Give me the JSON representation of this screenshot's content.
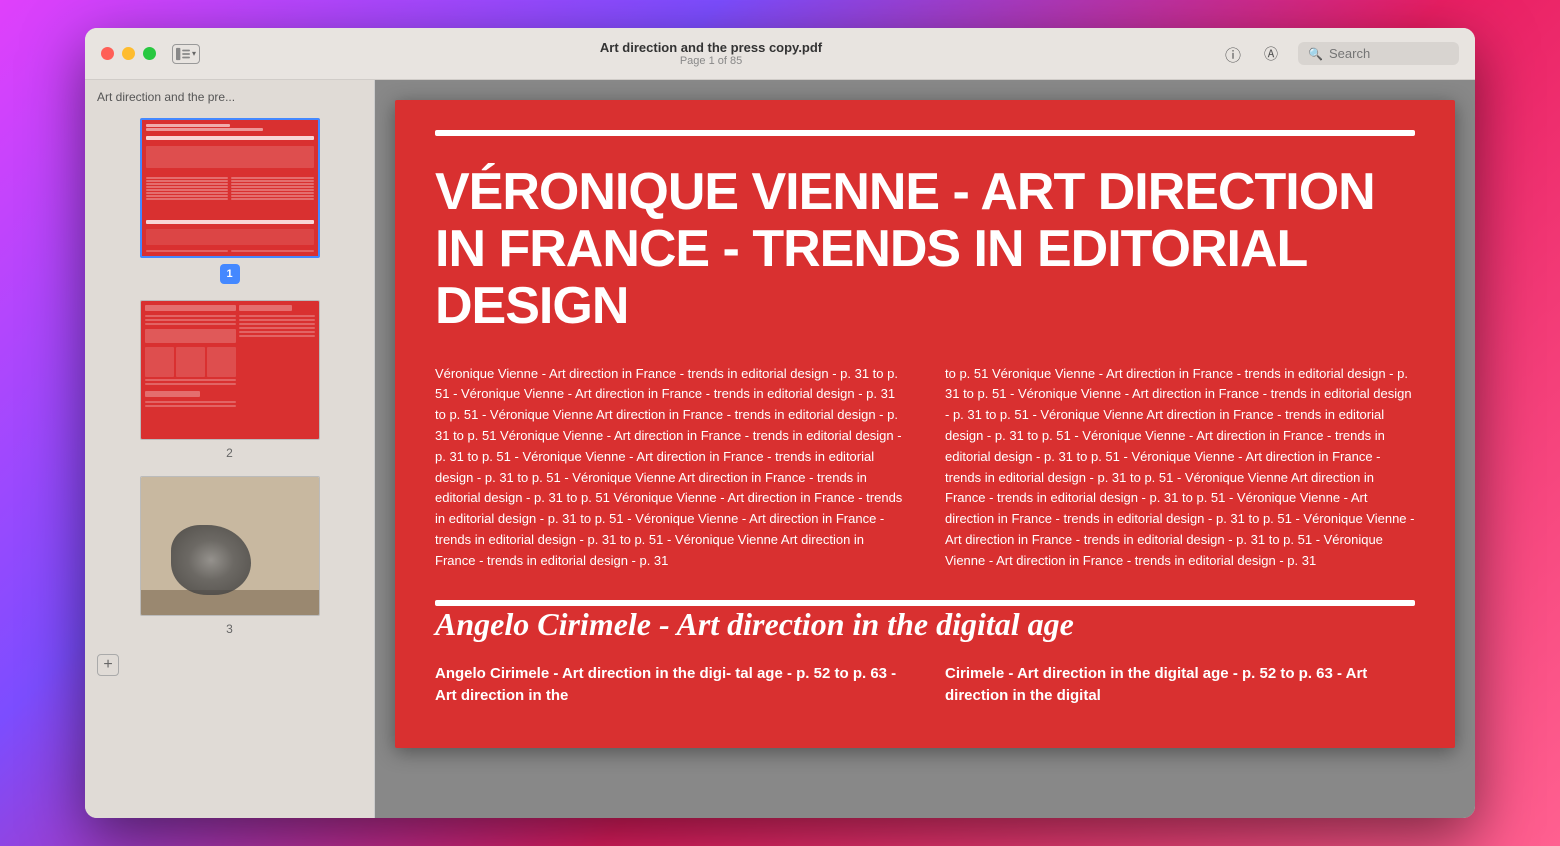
{
  "window": {
    "title": "Art direction and the press copy.pdf",
    "page_info": "Page 1 of 85",
    "search_placeholder": "Search"
  },
  "sidebar": {
    "header": "Art direction and the pre...",
    "pages": [
      {
        "num": "1",
        "label": "1",
        "active": true
      },
      {
        "num": "2",
        "label": "2",
        "active": false
      },
      {
        "num": "3",
        "label": "3",
        "active": false
      }
    ],
    "add_button": "+"
  },
  "pdf": {
    "main_title": "VÉRONIQUE VIENNE - ART DIRECTION IN FRANCE - TRENDS IN EDITORIAL DESIGN",
    "body_text_left": "Véronique Vienne - Art direction in France - trends in editorial design - p. 31 to p. 51 - Véronique Vienne - Art direction in France - trends in editorial design - p. 31 to p. 51 - Véronique Vienne Art direction in France - trends in editorial design - p. 31 to p. 51 Véronique Vienne - Art direction in France - trends in editorial design - p. 31 to p. 51 - Véronique Vienne - Art direction in France - trends in editorial design - p. 31 to p. 51 - Véronique Vienne Art direction in France - trends in editorial design - p. 31 to p. 51 Véronique Vienne - Art direction in France - trends in editorial design - p. 31 to p. 51 - Véronique Vienne - Art direction in France - trends in editorial design - p. 31 to p. 51 - Véronique Vienne Art direction in France - trends in editorial design - p. 31",
    "body_text_right": "to p. 51 Véronique Vienne - Art direction in France - trends in editorial design - p. 31 to p. 51 - Véronique Vienne - Art direction in France - trends in editorial design - p. 31 to p. 51 - Véronique Vienne Art direction in France - trends in editorial design - p. 31 to p. 51 - Véronique Vienne - Art direction in France - trends in editorial design - p. 31 to p. 51 - Véronique Vienne - Art direction in France - trends in editorial design - p. 31 to p. 51 - Véronique Vienne Art direction in France - trends in editorial design - p. 31 to p. 51 - Véronique Vienne - Art direction in France - trends in editorial design - p. 31 to p. 51 - Véronique Vienne - Art direction in France - trends in editorial design - p. 31 to p. 51 - Véronique Vienne - Art direction in France - trends in editorial design - p. 31",
    "section2_title": "Angelo Cirimele - Art direction in the digital age",
    "section2_left": "Angelo Cirimele - Art direction in the digi- tal age - p. 52 to p. 63 - Art direction in the",
    "section2_right": "Cirimele - Art direction in the digital age - p. 52 to p. 63 - Art direction in the digital"
  },
  "icons": {
    "info": "ⓘ",
    "annotate": "Ⓐ",
    "search": "🔍",
    "sidebar_toggle": "⊞",
    "plus": "+"
  }
}
